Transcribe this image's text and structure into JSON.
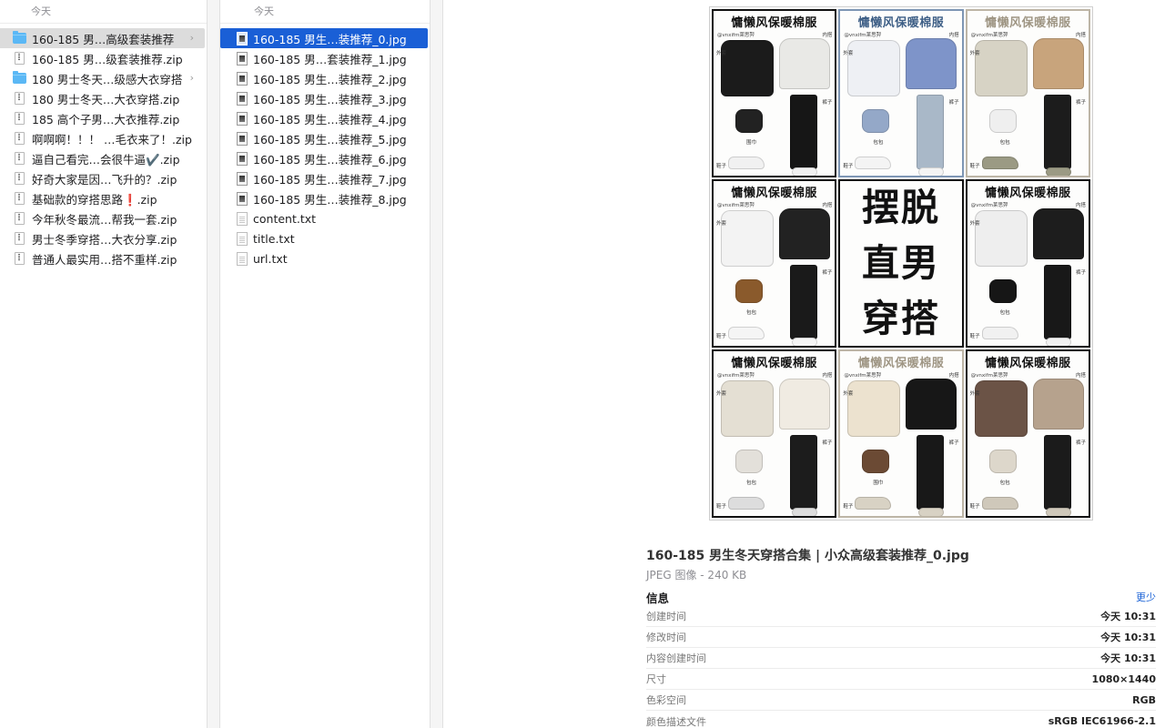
{
  "column1": {
    "header": "今天",
    "items": [
      {
        "icon": "folder",
        "label": "160-185 男…高级套装推荐",
        "selected": true,
        "chevron": "›"
      },
      {
        "icon": "zip",
        "label": "160-185 男…级套装推荐.zip"
      },
      {
        "icon": "folder",
        "label": "180 男士冬天…级感大衣穿搭",
        "chevron": "›"
      },
      {
        "icon": "zip",
        "label": "180 男士冬天…大衣穿搭.zip"
      },
      {
        "icon": "zip",
        "label": "185 高个子男…大衣推荐.zip"
      },
      {
        "icon": "zip",
        "label": "啊啊啊！！！ …毛衣来了！.zip"
      },
      {
        "icon": "zip",
        "label": "逼自己看完…会很牛逼✔️.zip"
      },
      {
        "icon": "zip",
        "label": "好奇大家是因…飞升的？.zip"
      },
      {
        "icon": "zip",
        "label": "基础款的穿搭思路❗️.zip"
      },
      {
        "icon": "zip",
        "label": "今年秋冬最流…帮我一套.zip"
      },
      {
        "icon": "zip",
        "label": "男士冬季穿搭…大衣分享.zip"
      },
      {
        "icon": "zip",
        "label": "普通人最实用…搭不重样.zip"
      }
    ]
  },
  "column2": {
    "header": "今天",
    "items": [
      {
        "icon": "image",
        "label": "160-185 男生…装推荐_0.jpg",
        "selected": true
      },
      {
        "icon": "image",
        "label": "160-185 男…套装推荐_1.jpg"
      },
      {
        "icon": "image",
        "label": "160-185 男生…装推荐_2.jpg"
      },
      {
        "icon": "image",
        "label": "160-185 男生…装推荐_3.jpg"
      },
      {
        "icon": "image",
        "label": "160-185 男生…装推荐_4.jpg"
      },
      {
        "icon": "image",
        "label": "160-185 男生…装推荐_5.jpg"
      },
      {
        "icon": "image",
        "label": "160-185 男生…装推荐_6.jpg"
      },
      {
        "icon": "image",
        "label": "160-185 男生…装推荐_7.jpg"
      },
      {
        "icon": "image",
        "label": "160-185 男生…装推荐_8.jpg"
      },
      {
        "icon": "text",
        "label": "content.txt"
      },
      {
        "icon": "text",
        "label": "title.txt"
      },
      {
        "icon": "text",
        "label": "url.txt"
      }
    ]
  },
  "preview": {
    "tile_title": "慵懒风保暖棉服",
    "tile_handle": "@vnxifm莱思羿",
    "labels": {
      "outer": "外套",
      "inner": "内搭",
      "pants": "裤子",
      "shoes": "鞋子",
      "bag": "包包",
      "scarf": "围巾"
    },
    "center_lines": [
      "摆脱",
      "直男",
      "穿搭"
    ],
    "tiles": [
      {
        "frame": "dark",
        "jacket": "#1b1b1b",
        "sweater": "#e9e9e6",
        "pants": "#161616",
        "acc": "#222222",
        "shoe": "#f1f1f1",
        "acc_label": "scarf"
      },
      {
        "frame": "blue",
        "jacket": "#eef0f4",
        "sweater": "#7e94c9",
        "pants": "#a9b8c8",
        "acc": "#94a8c8",
        "shoe": "#f4f4f4",
        "acc_label": "bag"
      },
      {
        "frame": "beige",
        "jacket": "#d7d3c5",
        "sweater": "#c8a47c",
        "pants": "#1c1c1c",
        "acc": "#efefef",
        "shoe": "#9b9a84",
        "acc_label": "bag"
      },
      {
        "frame": "dark",
        "jacket": "#f3f3f3",
        "sweater": "#222222",
        "pants": "#1a1a1a",
        "acc": "#8a5a2c",
        "shoe": "#f5f5f5",
        "acc_label": "bag"
      },
      {
        "center": true
      },
      {
        "frame": "dark",
        "jacket": "#eeeeee",
        "sweater": "#1d1d1d",
        "pants": "#181818",
        "acc": "#161616",
        "shoe": "#f1f1f1",
        "acc_label": "bag"
      },
      {
        "frame": "dark",
        "jacket": "#e4dfd3",
        "sweater": "#f0ebe2",
        "pants": "#1c1c1c",
        "acc": "#e3e0da",
        "shoe": "#dddddd",
        "acc_label": "bag"
      },
      {
        "frame": "beige",
        "jacket": "#ece2cf",
        "sweater": "#171717",
        "pants": "#181818",
        "acc": "#6b4a34",
        "shoe": "#d8d2c4",
        "acc_label": "scarf"
      },
      {
        "frame": "dark",
        "jacket": "#6b5346",
        "sweater": "#b6a28d",
        "pants": "#1b1b1b",
        "acc": "#ddd7cb",
        "shoe": "#cfc8ba",
        "acc_label": "bag"
      }
    ],
    "file_title": "160-185 男生冬天穿搭合集 | 小众高级套装推荐_0.jpg",
    "file_kind": "JPEG 图像 - 240 KB",
    "info_header": "信息",
    "less_link": "更少",
    "info_rows": [
      {
        "key": "创建时间",
        "value": "今天 10:31"
      },
      {
        "key": "修改时间",
        "value": "今天 10:31"
      },
      {
        "key": "内容创建时间",
        "value": "今天 10:31"
      },
      {
        "key": "尺寸",
        "value": "1080×1440"
      },
      {
        "key": "色彩空间",
        "value": "RGB"
      },
      {
        "key": "颜色描述文件",
        "value": "sRGB IEC61966-2.1"
      }
    ]
  },
  "colors": {
    "selection_blue": "#1a5fd6",
    "selection_grey": "#dcdcdc",
    "folder": "#5bb8f5",
    "link": "#1a62d6"
  }
}
